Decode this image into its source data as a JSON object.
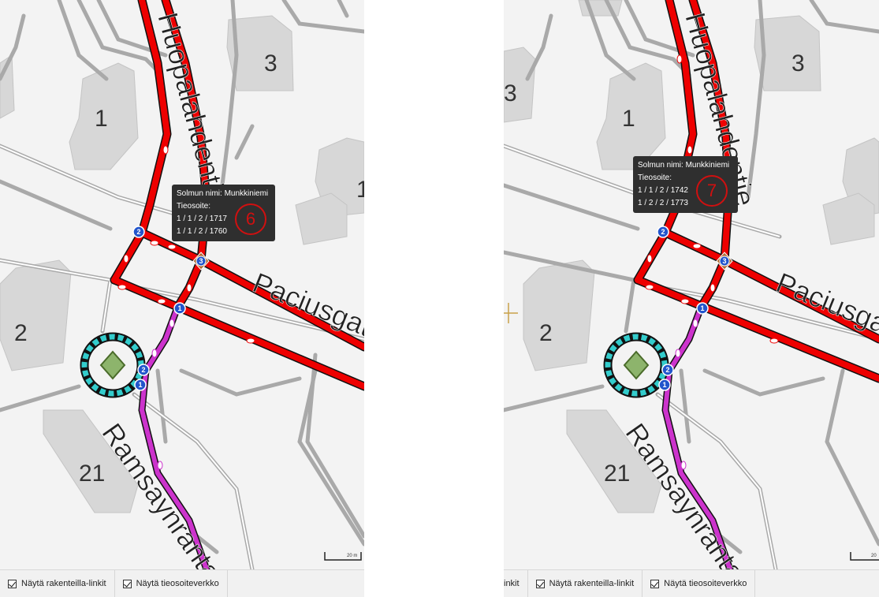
{
  "panels": [
    {
      "tooltip": {
        "title": "Solmun nimi: Munkkiniemi",
        "address_label": "Tieosoite:",
        "addresses": [
          "1 / 1 / 2 / 1717",
          "1 / 1 / 2 / 1760"
        ],
        "annotation": "6"
      },
      "buildings": [
        "1",
        "2",
        "3",
        "21",
        "1"
      ],
      "streets": [
        "Huopalahdentie",
        "Paciusgatan",
        "Ramsaynranta"
      ],
      "node_numbers": [
        "1",
        "2",
        "3",
        "1",
        "2"
      ],
      "scale_label": "20 m",
      "bottom_bar": {
        "items": [
          {
            "label": "Näytä rakenteilla-linkit",
            "checked": true
          },
          {
            "label": "Näytä tieosoiteverkko",
            "checked": true
          }
        ]
      }
    },
    {
      "tooltip": {
        "title": "Solmun nimi: Munkkiniemi",
        "address_label": "Tieosoite:",
        "addresses": [
          "1 / 1 / 2 / 1742",
          "1 / 2 / 2 / 1773"
        ],
        "annotation": "7"
      },
      "buildings": [
        "3",
        "1",
        "3",
        "2",
        "21"
      ],
      "streets": [
        "Huopalahdentie",
        "Paciusgatan",
        "Ramsaynranta"
      ],
      "node_numbers": [
        "1",
        "2",
        "3",
        "1",
        "2"
      ],
      "scale_label": "20",
      "bottom_bar": {
        "items": [
          {
            "label": "inkit",
            "checked": false
          },
          {
            "label": "Näytä rakenteilla-linkit",
            "checked": true
          },
          {
            "label": "Näytä tieosoiteverkko",
            "checked": true
          }
        ]
      }
    }
  ],
  "colors": {
    "road_red": "#ee0000",
    "road_purple": "#cc33cc",
    "roundabout_cyan": "#33cccc",
    "node_blue": "#2255cc",
    "tooltip_bg": "#2f2f2f",
    "annotation_red": "#d01010"
  }
}
